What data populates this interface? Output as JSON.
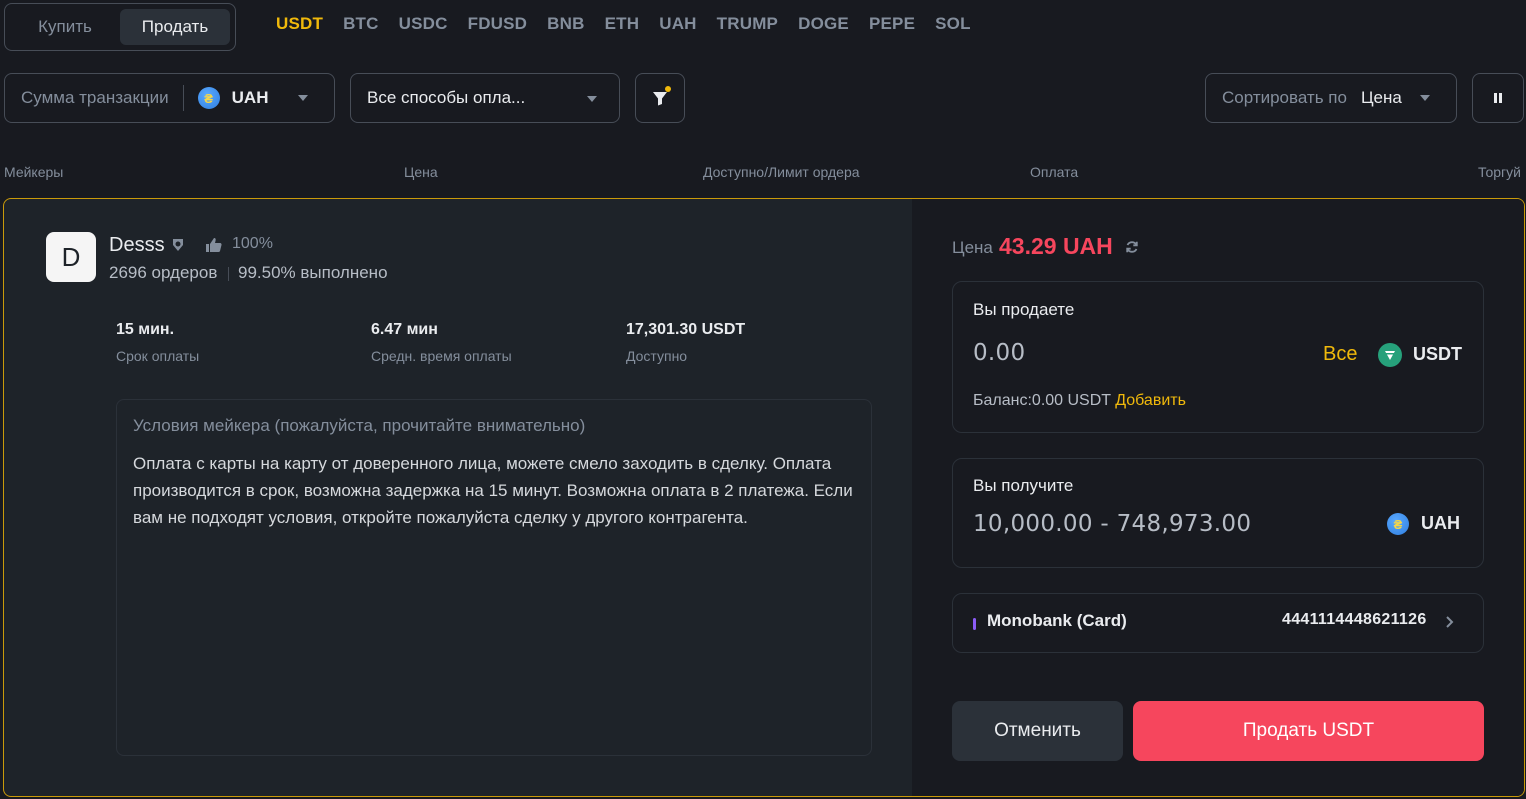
{
  "trade_toggle": {
    "buy": "Купить",
    "sell": "Продать",
    "active": "sell"
  },
  "assets": [
    "USDT",
    "BTC",
    "USDC",
    "FDUSD",
    "BNB",
    "ETH",
    "UAH",
    "TRUMP",
    "DOGE",
    "PEPE",
    "SOL"
  ],
  "active_asset": "USDT",
  "filters": {
    "amount_label": "Сумма транзакции",
    "fiat": "UAH",
    "payment": "Все способы опла...",
    "sort_label": "Сортировать по",
    "sort_value": "Цена"
  },
  "columns": {
    "makers": "Мейкеры",
    "price": "Цена",
    "available": "Доступно/Лимит ордера",
    "payment": "Оплата",
    "trade": "Торгуй"
  },
  "merchant": {
    "initial": "D",
    "name": "Desss",
    "rating": "100%",
    "orders": "2696 ордеров",
    "completion": "99.50% выполнено"
  },
  "stats": [
    {
      "value": "15 мин.",
      "label": "Срок оплаты"
    },
    {
      "value": "6.47 мин",
      "label": "Средн. время оплаты"
    },
    {
      "value": "17,301.30 USDT",
      "label": "Доступно"
    }
  ],
  "terms": {
    "title": "Условия мейкера (пожалуйста, прочитайте внимательно)",
    "body": "Оплата с карты на карту от доверенного лица, можете смело заходить в сделку. Оплата производится в срок, возможна задержка на 15 минут. Возможна оплата в 2 платежа. Если вам не подходят условия, откройте пожалуйста сделку у другого контрагента."
  },
  "order": {
    "price_label": "Цена",
    "price_value": "43.29 UAH",
    "sell_label": "Вы продаете",
    "sell_amount": "0.00",
    "all_label": "Все",
    "sell_currency": "USDT",
    "balance_prefix": "Баланс:0.00 USDT",
    "add_label": "Добавить",
    "receive_label": "Вы получите",
    "receive_range": "10,000.00 - 748,973.00",
    "receive_currency": "UAH",
    "bank_name": "Monobank (Card)",
    "bank_account": "4441114448621126",
    "cancel_label": "Отменить",
    "submit_label": "Продать USDT"
  },
  "colors": {
    "accent": "#f0b90b",
    "sell": "#f6465d",
    "background": "#181a20",
    "card": "#1e2329"
  }
}
